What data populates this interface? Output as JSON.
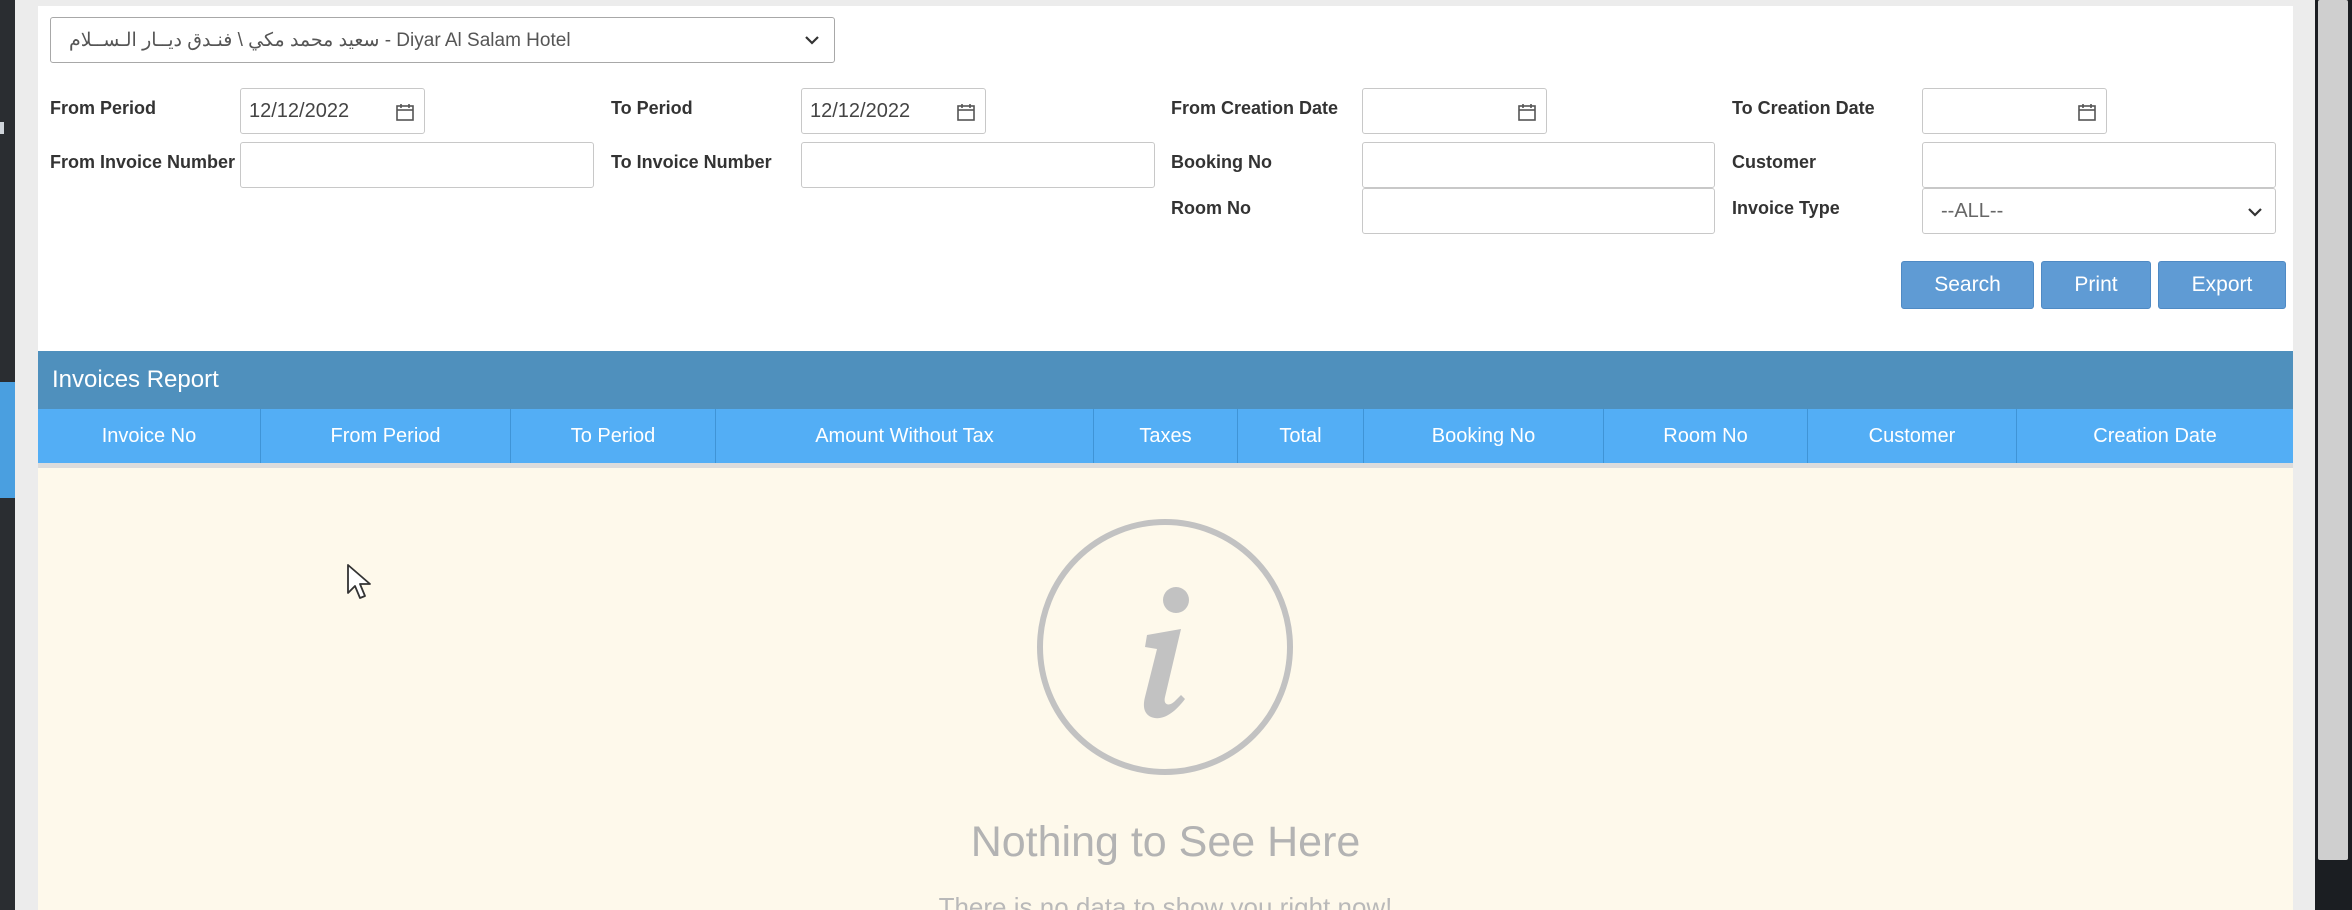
{
  "hotel_select": {
    "value": "سعيد محمد مكي \\ فنـدق ديــار الـســلام - Diyar Al Salam Hotel"
  },
  "filters": {
    "from_period": {
      "label": "From Period",
      "value": "12/12/2022"
    },
    "to_period": {
      "label": "To Period",
      "value": "12/12/2022"
    },
    "from_creation_date": {
      "label": "From Creation Date",
      "value": ""
    },
    "to_creation_date": {
      "label": "To Creation Date",
      "value": ""
    },
    "from_invoice_number": {
      "label": "From Invoice Number",
      "value": ""
    },
    "to_invoice_number": {
      "label": "To Invoice Number",
      "value": ""
    },
    "booking_no": {
      "label": "Booking No",
      "value": ""
    },
    "customer": {
      "label": "Customer",
      "value": ""
    },
    "room_no": {
      "label": "Room No",
      "value": ""
    },
    "invoice_type": {
      "label": "Invoice Type",
      "value": "--ALL--"
    }
  },
  "buttons": {
    "search": "Search",
    "print": "Print",
    "export": "Export"
  },
  "report": {
    "title": "Invoices Report",
    "columns": [
      "Invoice No",
      "From Period",
      "To Period",
      "Amount Without Tax",
      "Taxes",
      "Total",
      "Booking No",
      "Room No",
      "Customer",
      "Creation Date"
    ]
  },
  "empty_state": {
    "title": "Nothing to See Here",
    "subtitle": "There is no data to show you right now!"
  },
  "colors": {
    "title_bar": "#4f90bd",
    "column_header": "#53aef5",
    "button": "#5f9bd4",
    "empty_background": "#fef9eb"
  },
  "icons": [
    "chevron-down-icon",
    "calendar-icon",
    "info-icon",
    "mouse-cursor-icon"
  ]
}
